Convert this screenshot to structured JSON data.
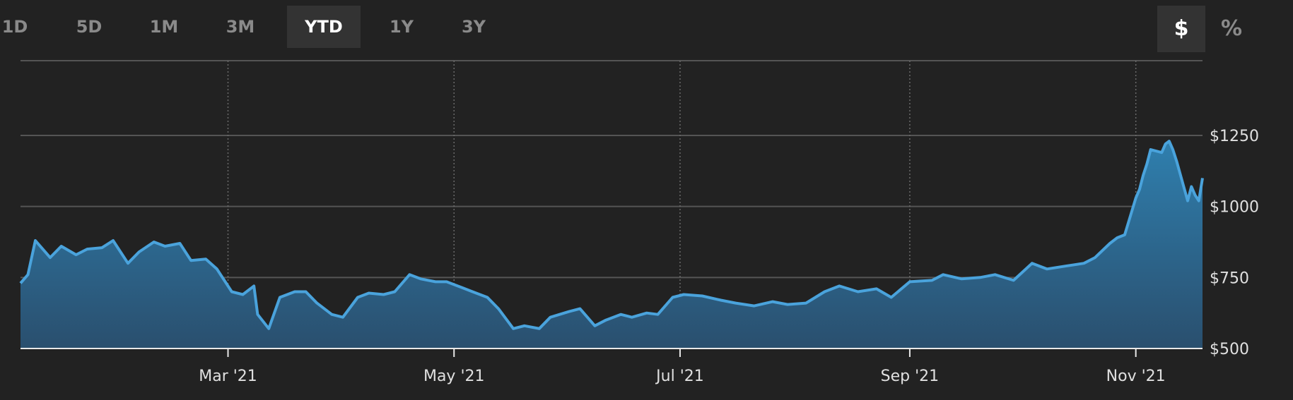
{
  "ranges": [
    {
      "label": "1D",
      "active": false
    },
    {
      "label": "5D",
      "active": false
    },
    {
      "label": "1M",
      "active": false
    },
    {
      "label": "3M",
      "active": false
    },
    {
      "label": "YTD",
      "active": true
    },
    {
      "label": "1Y",
      "active": false
    },
    {
      "label": "3Y",
      "active": false
    }
  ],
  "modes": [
    {
      "label": "$",
      "active": true
    },
    {
      "label": "%",
      "active": false
    }
  ],
  "colors": {
    "background": "#222222",
    "line": "#4aa3dc",
    "fill_top": "#2f7fae",
    "fill_bottom": "#2a4f6e",
    "grid": "#555555",
    "axis_text": "#e0e0e0"
  },
  "chart_data": {
    "type": "area",
    "title": "",
    "xlabel": "",
    "ylabel": "",
    "ylim": [
      500,
      1250
    ],
    "yticks": [
      {
        "value": 500,
        "label": "$500"
      },
      {
        "value": 750,
        "label": "$750"
      },
      {
        "value": 1000,
        "label": "$1000"
      },
      {
        "value": 1250,
        "label": "$1250"
      }
    ],
    "xlim": [
      "2021-01-04",
      "2021-11-19"
    ],
    "xticks": [
      {
        "date": "2021-03-01",
        "label": "Mar '21"
      },
      {
        "date": "2021-05-01",
        "label": "May '21"
      },
      {
        "date": "2021-07-01",
        "label": "Jul '21"
      },
      {
        "date": "2021-09-01",
        "label": "Sep '21"
      },
      {
        "date": "2021-11-01",
        "label": "Nov '21"
      }
    ],
    "grid": true,
    "series": [
      {
        "x": [
          "2021-01-04",
          "2021-01-06",
          "2021-01-08",
          "2021-01-12",
          "2021-01-15",
          "2021-01-19",
          "2021-01-22",
          "2021-01-26",
          "2021-01-29",
          "2021-02-02",
          "2021-02-05",
          "2021-02-09",
          "2021-02-12",
          "2021-02-16",
          "2021-02-19",
          "2021-02-23",
          "2021-02-26",
          "2021-03-02",
          "2021-03-05",
          "2021-03-08",
          "2021-03-09",
          "2021-03-12",
          "2021-03-15",
          "2021-03-19",
          "2021-03-22",
          "2021-03-25",
          "2021-03-29",
          "2021-04-01",
          "2021-04-05",
          "2021-04-08",
          "2021-04-12",
          "2021-04-15",
          "2021-04-19",
          "2021-04-22",
          "2021-04-26",
          "2021-04-29",
          "2021-05-03",
          "2021-05-06",
          "2021-05-10",
          "2021-05-13",
          "2021-05-17",
          "2021-05-20",
          "2021-05-24",
          "2021-05-27",
          "2021-06-01",
          "2021-06-04",
          "2021-06-08",
          "2021-06-11",
          "2021-06-15",
          "2021-06-18",
          "2021-06-22",
          "2021-06-25",
          "2021-06-29",
          "2021-07-02",
          "2021-07-07",
          "2021-07-12",
          "2021-07-16",
          "2021-07-21",
          "2021-07-26",
          "2021-07-30",
          "2021-08-04",
          "2021-08-09",
          "2021-08-13",
          "2021-08-18",
          "2021-08-23",
          "2021-08-27",
          "2021-09-01",
          "2021-09-07",
          "2021-09-10",
          "2021-09-15",
          "2021-09-20",
          "2021-09-24",
          "2021-09-29",
          "2021-10-04",
          "2021-10-08",
          "2021-10-13",
          "2021-10-18",
          "2021-10-21",
          "2021-10-25",
          "2021-10-27",
          "2021-10-29",
          "2021-11-01",
          "2021-11-02",
          "2021-11-03",
          "2021-11-04",
          "2021-11-05",
          "2021-11-08",
          "2021-11-09",
          "2021-11-10",
          "2021-11-11",
          "2021-11-12",
          "2021-11-15",
          "2021-11-16",
          "2021-11-17",
          "2021-11-18",
          "2021-11-19"
        ],
        "y": [
          730,
          760,
          880,
          820,
          860,
          830,
          850,
          855,
          880,
          800,
          840,
          875,
          860,
          870,
          810,
          815,
          780,
          700,
          690,
          720,
          620,
          570,
          680,
          700,
          700,
          660,
          620,
          610,
          680,
          695,
          690,
          700,
          760,
          745,
          735,
          735,
          715,
          700,
          680,
          640,
          570,
          580,
          570,
          610,
          630,
          640,
          580,
          600,
          620,
          610,
          625,
          620,
          680,
          690,
          685,
          670,
          660,
          650,
          665,
          655,
          660,
          700,
          720,
          700,
          710,
          680,
          735,
          740,
          760,
          745,
          750,
          760,
          740,
          800,
          780,
          790,
          800,
          820,
          870,
          890,
          900,
          1030,
          1060,
          1110,
          1150,
          1200,
          1190,
          1220,
          1230,
          1200,
          1160,
          1020,
          1070,
          1040,
          1020,
          1100
        ]
      }
    ]
  }
}
